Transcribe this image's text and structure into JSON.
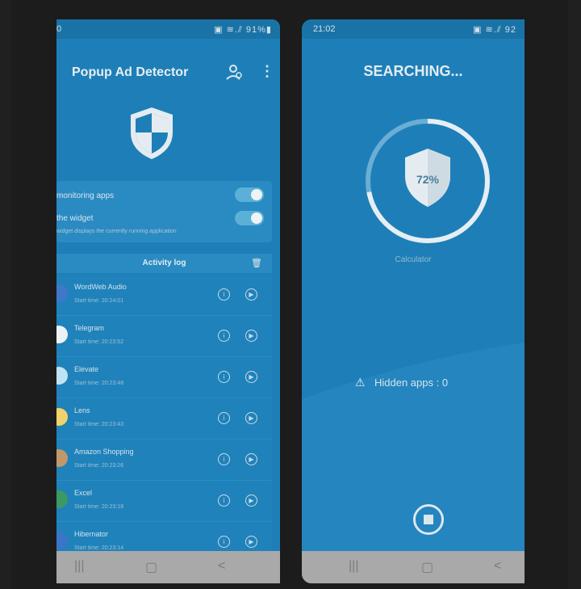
{
  "left": {
    "status": {
      "time": "0",
      "icons": "▣ ≋.⫽ 91%▮"
    },
    "app_title": "Popup Ad Detector",
    "settings": {
      "monitoring_label": "monitoring apps",
      "widget_label": "the widget",
      "widget_sub": "widget displays the currently running application"
    },
    "activity": {
      "header": "Activity log",
      "rows": [
        {
          "name": "WordWeb Audio",
          "time": "Start time: 20:24:01",
          "icon_color": "#3f78c9"
        },
        {
          "name": "Telegram",
          "time": "Start time: 20:23:52",
          "icon_color": "#eaf2f6"
        },
        {
          "name": "Elevate",
          "time": "Start time: 20:23:48",
          "icon_color": "#bfe3f2"
        },
        {
          "name": "Lens",
          "time": "Start time: 20:23:43",
          "icon_color": "#f2d36b"
        },
        {
          "name": "Amazon Shopping",
          "time": "Start time: 20:23:26",
          "icon_color": "#c2986a"
        },
        {
          "name": "Excel",
          "time": "Start time: 20:23:18",
          "icon_color": "#3b9a63"
        },
        {
          "name": "Hibernator",
          "time": "Start time: 20:23:14",
          "icon_color": "#3a76c8"
        }
      ]
    },
    "nav": {
      "recent": "|||",
      "home": "▢",
      "back": "<"
    }
  },
  "right": {
    "status": {
      "time": "21:02",
      "icons": "▣ ≋.⫽ 92"
    },
    "title": "SEARCHING...",
    "progress": {
      "percent_label": "72%",
      "value": 0.72
    },
    "current_app": "Calculator",
    "hidden_apps": "Hidden apps : 0",
    "nav": {
      "recent": "|||",
      "home": "▢",
      "back": "<"
    }
  }
}
